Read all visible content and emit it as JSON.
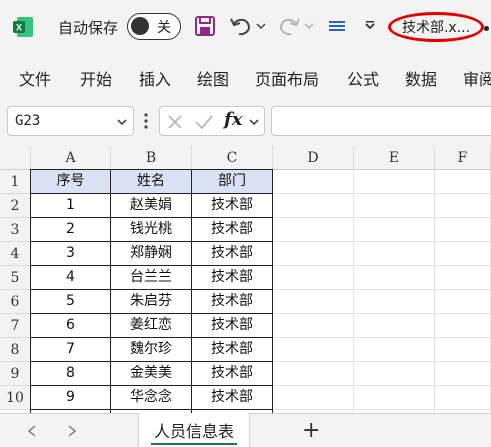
{
  "titlebar": {
    "autosave_label": "自动保存",
    "autosave_state": "关",
    "filename": "技术部.x...",
    "icons": [
      "excel-logo-icon",
      "save-icon",
      "undo-icon",
      "redo-icon",
      "customize-icon",
      "dropdown-icon"
    ],
    "accent": "#e00000",
    "brand": "#1d7a46"
  },
  "ribbon": {
    "tabs": [
      "文件",
      "开始",
      "插入",
      "绘图",
      "页面布局",
      "公式",
      "数据",
      "审阅"
    ]
  },
  "formula_bar": {
    "name_box": "G23",
    "fx_label": "fx",
    "formula": ""
  },
  "grid": {
    "columns": [
      "A",
      "B",
      "C",
      "D",
      "E",
      "F"
    ],
    "rows": [
      "1",
      "2",
      "3",
      "4",
      "5",
      "6",
      "7",
      "8",
      "9",
      "10"
    ],
    "header_fill": "#d9e1f2",
    "table": [
      [
        "序号",
        "姓名",
        "部门"
      ],
      [
        "1",
        "赵美娟",
        "技术部"
      ],
      [
        "2",
        "钱光桃",
        "技术部"
      ],
      [
        "3",
        "郑静娴",
        "技术部"
      ],
      [
        "4",
        "台兰兰",
        "技术部"
      ],
      [
        "5",
        "朱启芬",
        "技术部"
      ],
      [
        "6",
        "姜红恋",
        "技术部"
      ],
      [
        "7",
        "魏尔珍",
        "技术部"
      ],
      [
        "8",
        "金美美",
        "技术部"
      ],
      [
        "9",
        "华念念",
        "技术部"
      ]
    ]
  },
  "sheets": {
    "tabs": [
      "人员信息表"
    ],
    "add_label": "+"
  }
}
